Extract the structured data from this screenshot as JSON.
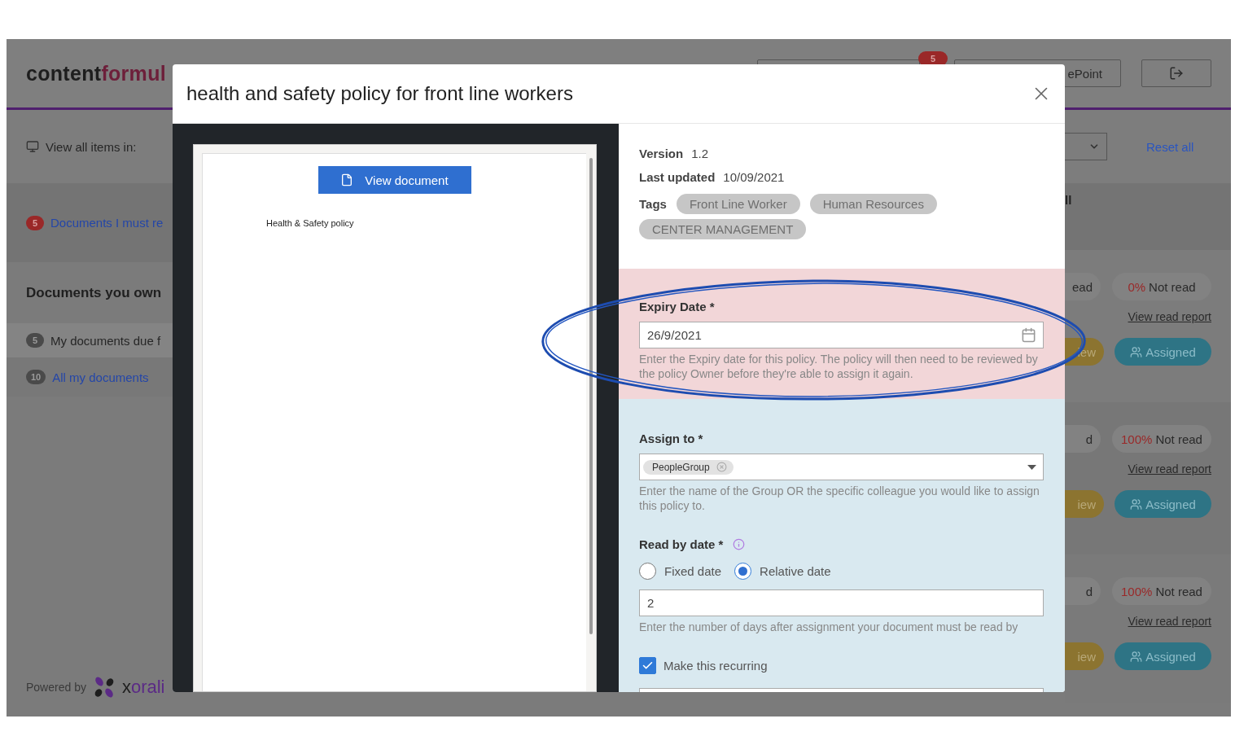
{
  "app": {
    "logo": {
      "dark": "content",
      "accent": "formul"
    },
    "header": {
      "notification_badge": "5",
      "sharepoint_button": "ePoint"
    },
    "filter": {
      "label": "View all items in:",
      "reset": "Reset all",
      "column_heading": "ll"
    },
    "sidebar": {
      "must_read": {
        "count": "5",
        "label": "Documents I must re"
      },
      "own_heading": "Documents you own",
      "own_items": [
        {
          "count": "5",
          "label": "My documents due f",
          "kind": "text"
        },
        {
          "count": "10",
          "label": "All my documents",
          "kind": "link"
        }
      ]
    },
    "cards": [
      {
        "read_fragment": "ead",
        "percent": "0%",
        "not_read": "Not read",
        "report": "View read report",
        "review_fragment": "iew",
        "assigned": "Assigned"
      },
      {
        "read_fragment": "d",
        "percent": "100%",
        "not_read": "Not read",
        "report": "View read report",
        "review_fragment": "iew",
        "assigned": "Assigned"
      },
      {
        "read_fragment": "d",
        "percent": "100%",
        "not_read": "Not read",
        "report": "View read report",
        "review_fragment": "iew",
        "assigned": "Assigned"
      }
    ],
    "footer": {
      "powered": "Powered by",
      "brand": {
        "dark": "x",
        "accent": "orali"
      }
    }
  },
  "modal": {
    "title": "health and safety policy for front line workers",
    "preview": {
      "button": "View document",
      "doc_title": "Health & Safety policy"
    },
    "details": [
      {
        "label": "Version",
        "value": "1.2"
      },
      {
        "label": "Last updated",
        "value": "10/09/2021"
      }
    ],
    "tags_label": "Tags",
    "tags": [
      "Front Line Worker",
      "Human Resources",
      "CENTER MANAGEMENT"
    ],
    "expiry": {
      "label": "Expiry Date *",
      "value": "26/9/2021",
      "help": "Enter the Expiry date for this policy. The policy will then need to be reviewed by the policy Owner before they're able to assign it again."
    },
    "assign": {
      "label": "Assign to *",
      "chips": [
        "PeopleGroup"
      ],
      "help": "Enter the name of the Group OR the specific colleague you would like to assign this policy to."
    },
    "read_by": {
      "label": "Read by date *",
      "options": [
        {
          "label": "Fixed date",
          "selected": false
        },
        {
          "label": "Relative date",
          "selected": true
        }
      ],
      "value": "2",
      "help": "Enter the number of days after assignment your document must be read by"
    },
    "recurring": {
      "label": "Make this recurring",
      "checked": true
    }
  }
}
